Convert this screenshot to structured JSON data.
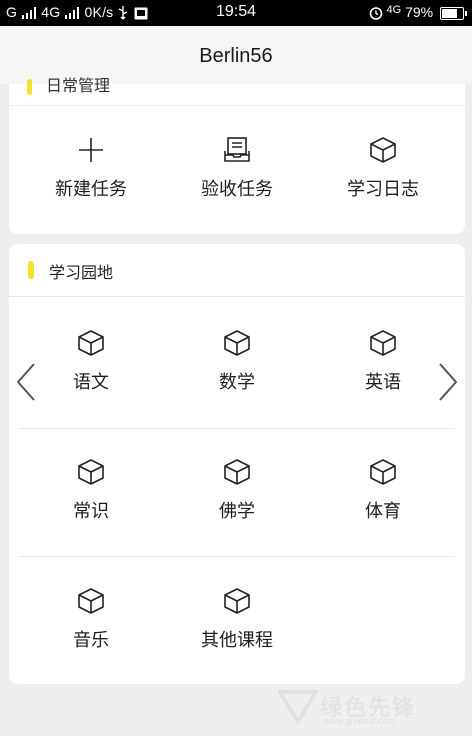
{
  "status_bar": {
    "left_text": "G",
    "carrier2": "4G",
    "speed": "0K/s",
    "time": "19:54",
    "network": "4G",
    "battery": "79%",
    "icons": [
      "signal-icon",
      "usb-icon",
      "notification-icon",
      "alarm-icon",
      "battery-icon"
    ]
  },
  "header": {
    "title": "Berlin56"
  },
  "card1": {
    "cut_title": "日常管理",
    "items": [
      {
        "label": "新建任务",
        "icon": "plus-icon"
      },
      {
        "label": "验收任务",
        "icon": "inbox-icon"
      },
      {
        "label": "学习日志",
        "icon": "cube-icon"
      }
    ]
  },
  "card2": {
    "title": "学习园地",
    "accent": "#f2e32c",
    "rows": [
      [
        {
          "label": "语文",
          "icon": "cube-icon"
        },
        {
          "label": "数学",
          "icon": "cube-icon"
        },
        {
          "label": "英语",
          "icon": "cube-icon"
        }
      ],
      [
        {
          "label": "常识",
          "icon": "cube-icon"
        },
        {
          "label": "佛学",
          "icon": "cube-icon"
        },
        {
          "label": "体育",
          "icon": "cube-icon"
        }
      ],
      [
        {
          "label": "音乐",
          "icon": "cube-icon"
        },
        {
          "label": "其他课程",
          "icon": "cube-icon"
        }
      ]
    ]
  },
  "watermark": {
    "text": "绿色先锋",
    "url": "www.greenxf.com"
  }
}
